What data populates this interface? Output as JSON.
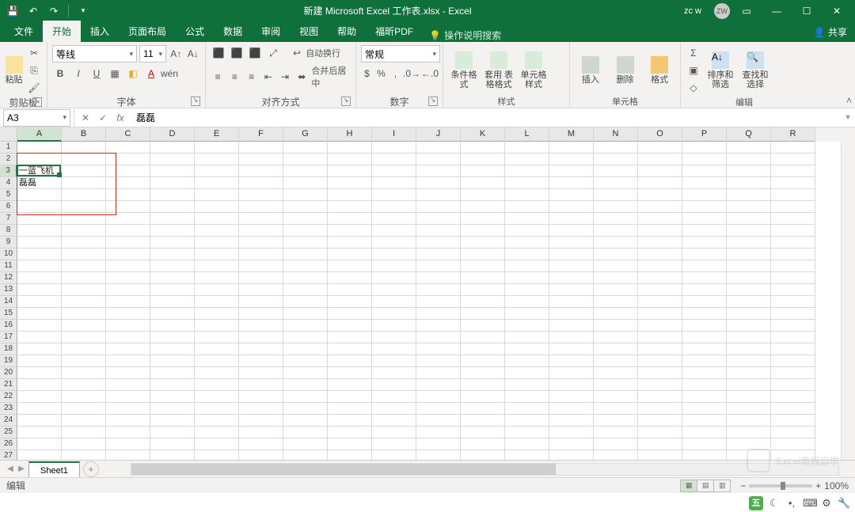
{
  "titlebar": {
    "title": "新建 Microsoft Excel 工作表.xlsx - Excel",
    "user": "zc w",
    "avatar": "ZW"
  },
  "tabs": {
    "file": "文件",
    "home": "开始",
    "insert": "插入",
    "layout": "页面布局",
    "formulas": "公式",
    "data": "数据",
    "review": "审阅",
    "view": "视图",
    "help": "帮助",
    "foxit": "福昕PDF",
    "tellme": "操作说明搜索",
    "share": "共享"
  },
  "ribbon": {
    "clipboard": {
      "paste": "粘贴",
      "label": "剪贴板"
    },
    "font": {
      "name": "等线",
      "size": "11",
      "label": "字体"
    },
    "alignment": {
      "wrap": "自动换行",
      "merge": "合并后居中",
      "label": "对齐方式"
    },
    "number": {
      "format": "常规",
      "label": "数字"
    },
    "styles": {
      "cond": "条件格式",
      "tbl": "套用\n表格格式",
      "cell": "单元格样式",
      "label": "样式"
    },
    "cells": {
      "insert": "插入",
      "delete": "删除",
      "format": "格式",
      "label": "单元格"
    },
    "editing": {
      "sort": "排序和筛选",
      "find": "查找和选择",
      "label": "编辑"
    }
  },
  "namebox": "A3",
  "formula": "磊磊",
  "columns": [
    "A",
    "B",
    "C",
    "D",
    "E",
    "F",
    "G",
    "H",
    "I",
    "J",
    "K",
    "L",
    "M",
    "N",
    "O",
    "P",
    "Q",
    "R"
  ],
  "rows": 27,
  "selected": {
    "col": 0,
    "row": 2
  },
  "celldata": {
    "A3": "一蓝飞机",
    "A4": "磊磊"
  },
  "redbox": {
    "top": 1,
    "left": 0,
    "rows": 5,
    "cols": 2
  },
  "sheet": {
    "name": "Sheet1"
  },
  "status": {
    "mode": "编辑",
    "zoom": "100%"
  },
  "watermark": "Excel教程自学",
  "ime": "五"
}
